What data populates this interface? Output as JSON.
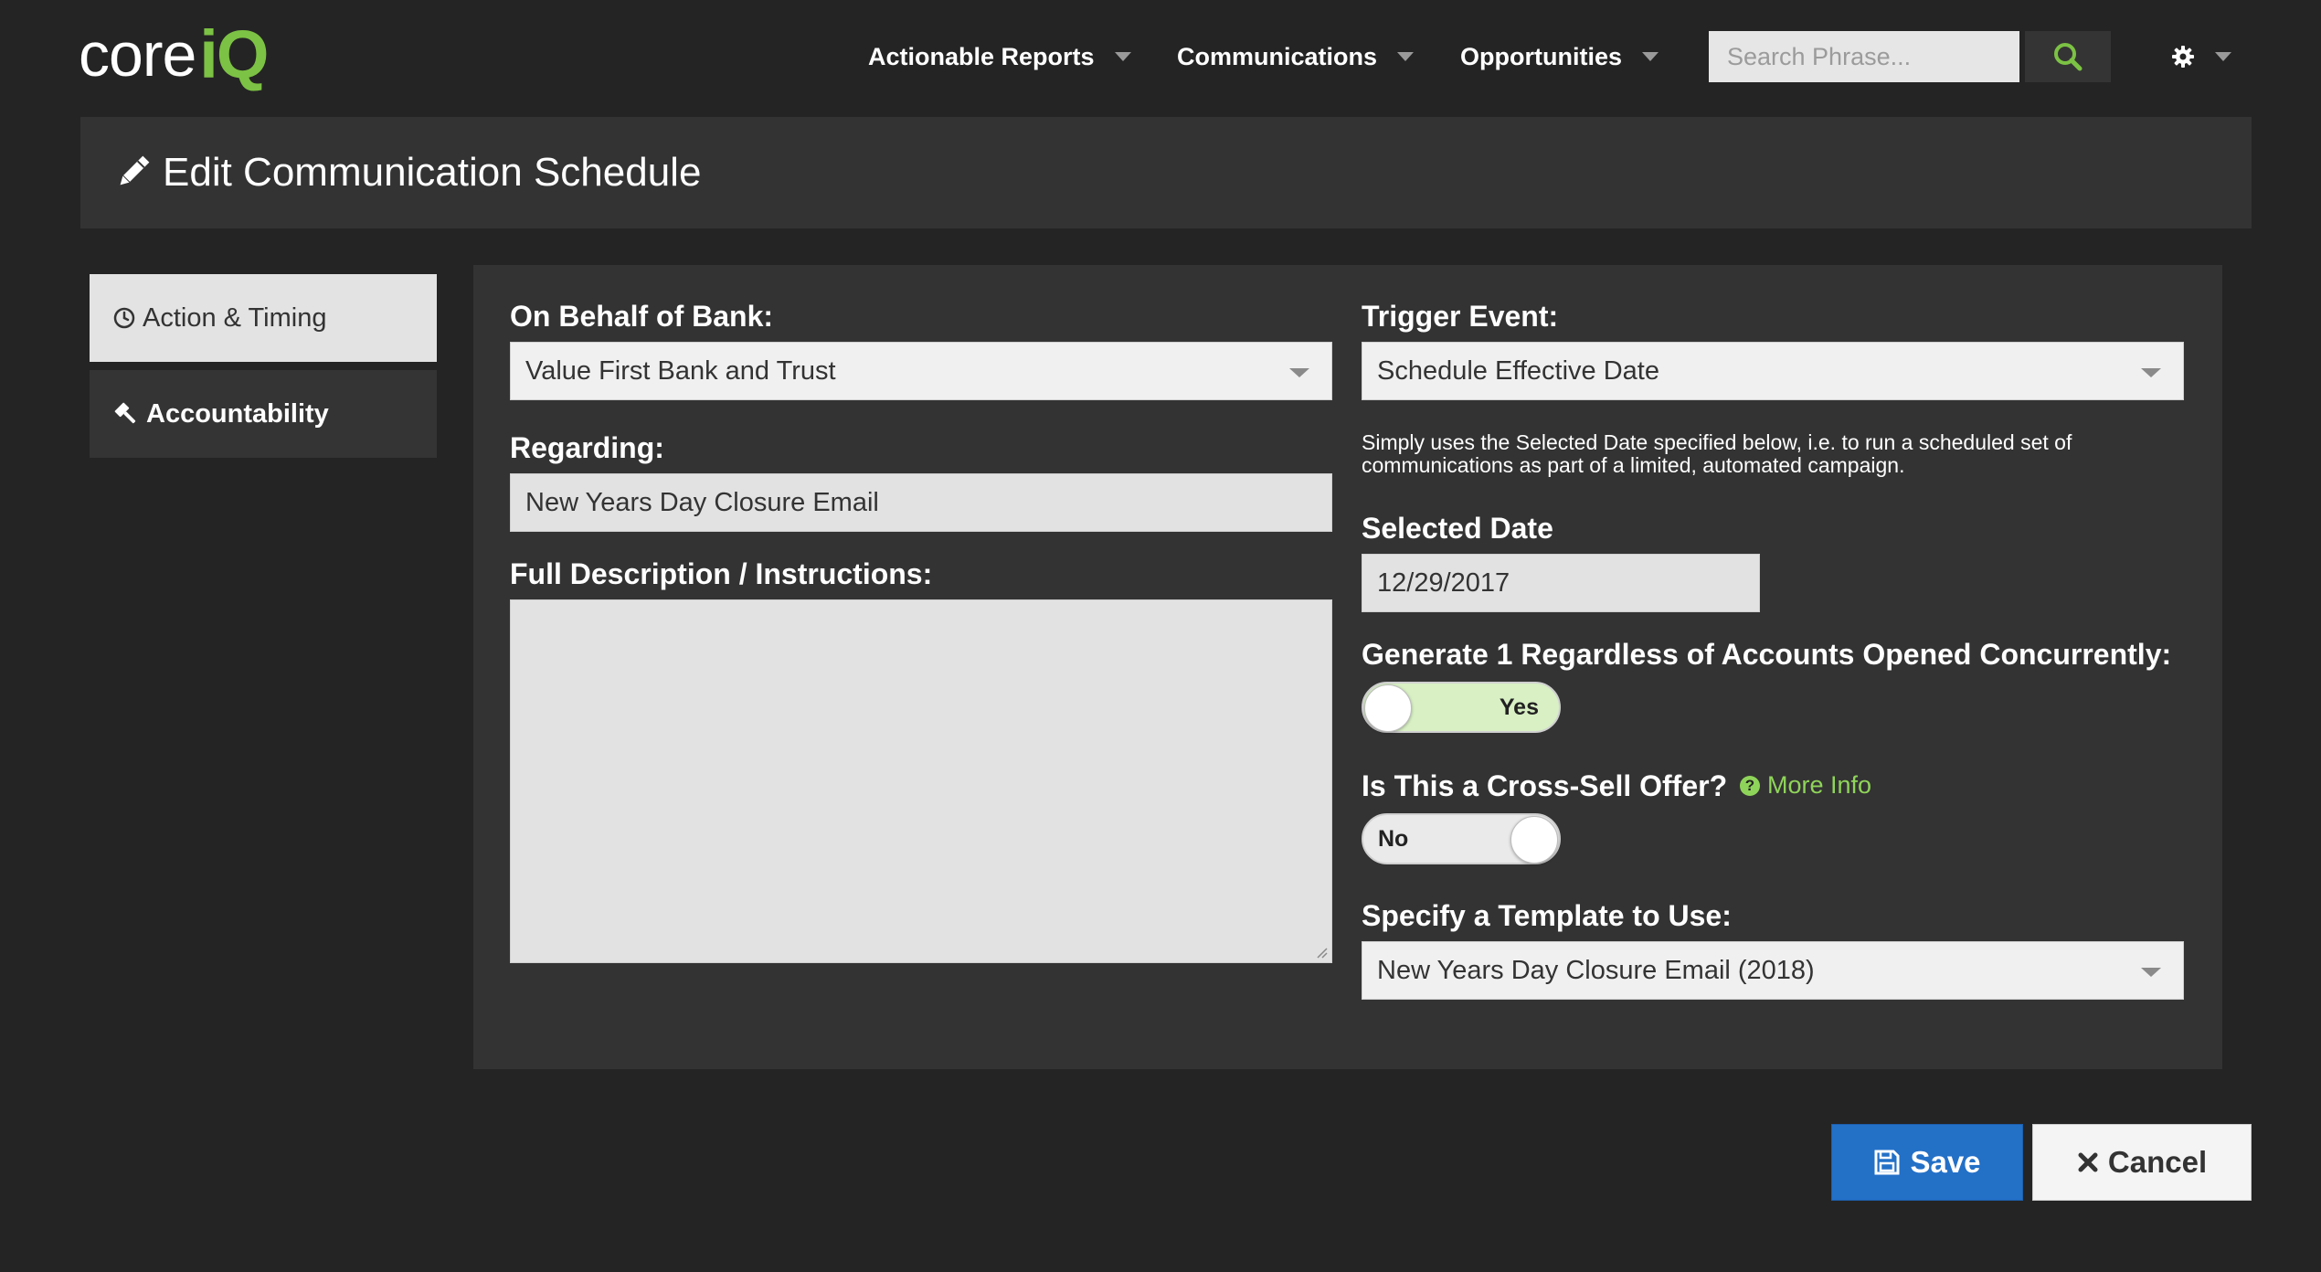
{
  "brand": {
    "part1": "core",
    "part2": "iQ",
    "accent": "#7cc244"
  },
  "nav": {
    "items": [
      {
        "label": "Actionable Reports"
      },
      {
        "label": "Communications"
      },
      {
        "label": "Opportunities"
      }
    ],
    "search_placeholder": "Search Phrase...",
    "search_icon": "search-icon",
    "settings_icon": "gear-icon"
  },
  "page": {
    "title": "Edit Communication Schedule",
    "title_icon": "pencil-icon"
  },
  "tabs": [
    {
      "label": "Action & Timing",
      "icon": "clock-icon",
      "active": true
    },
    {
      "label": "Accountability",
      "icon": "gavel-icon",
      "active": false
    }
  ],
  "form": {
    "bank": {
      "label": "On Behalf of Bank:",
      "value": "Value First Bank and Trust"
    },
    "regarding": {
      "label": "Regarding:",
      "value": "New Years Day Closure Email"
    },
    "description": {
      "label": "Full Description / Instructions:",
      "value": ""
    },
    "trigger": {
      "label": "Trigger Event:",
      "value": "Schedule Effective Date",
      "help": "Simply uses the Selected Date specified below, i.e. to run a scheduled set of communications as part of a limited, automated campaign."
    },
    "selected_date": {
      "label": "Selected Date",
      "value": "12/29/2017"
    },
    "generate_one": {
      "label": "Generate 1 Regardless of Accounts Opened Concurrently:",
      "state": "Yes",
      "on": true
    },
    "cross_sell": {
      "label": "Is This a Cross-Sell Offer?",
      "more_info": "More Info",
      "state": "No",
      "on": false
    },
    "template": {
      "label": "Specify a Template to Use:",
      "value": "New Years Day Closure Email (2018)"
    }
  },
  "buttons": {
    "save": "Save",
    "cancel": "Cancel"
  },
  "colors": {
    "background": "#242424",
    "panel": "#333333",
    "primary": "#2370c7",
    "link": "#8fd45a"
  }
}
